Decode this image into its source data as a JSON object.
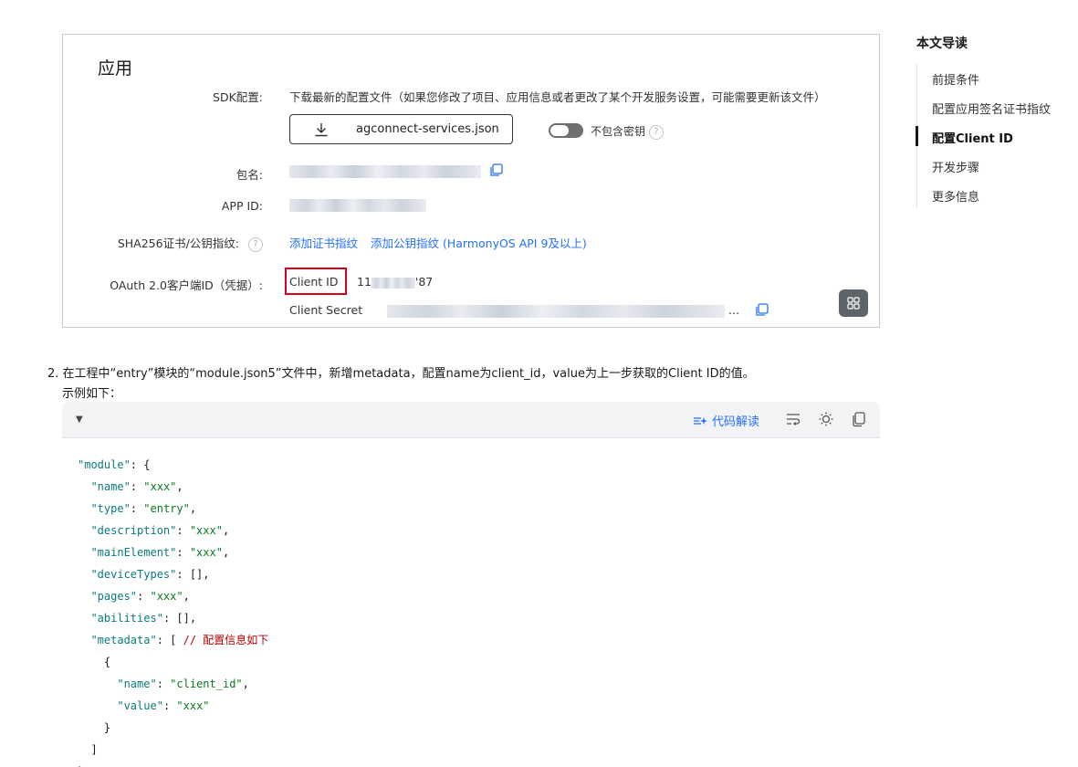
{
  "figure": {
    "title": "应用",
    "sdk_label": "SDK配置:",
    "sdk_desc": "下载最新的配置文件（如果您修改了项目、应用信息或者更改了某个开发服务设置，可能需要更新该文件）",
    "download_filename": "agconnect-services.json",
    "toggle_label": "不包含密钥",
    "package_label": "包名:",
    "appid_label": "APP ID:",
    "sha_label": "SHA256证书/公钥指纹:",
    "add_cert_link": "添加证书指纹",
    "add_pubkey_link": "添加公钥指纹 (HarmonyOS API 9及以上)",
    "oauth_label": "OAuth 2.0客户端ID（凭据）:",
    "client_id_label": "Client ID",
    "client_id_prefix": "11",
    "client_id_suffix": "'87",
    "client_secret_label": "Client Secret",
    "client_secret_ellipsis": "..."
  },
  "step": {
    "text": "2. 在工程中“entry”模块的“module.json5”文件中，新增metadata，配置name为client_id，value为上一步获取的Client ID的值。",
    "sub": "示例如下："
  },
  "code_toolbar": {
    "explain_label": "代码解读"
  },
  "toc": {
    "title": "本文导读",
    "items": [
      "前提条件",
      "配置应用签名证书指纹",
      "配置Client ID",
      "开发步骤",
      "更多信息"
    ]
  },
  "icons": [
    "download-icon",
    "help-icon",
    "copy-icon",
    "grid-icon",
    "collapse-triangle-icon",
    "wrap-icon",
    "theme-icon",
    "copy-code-icon"
  ]
}
